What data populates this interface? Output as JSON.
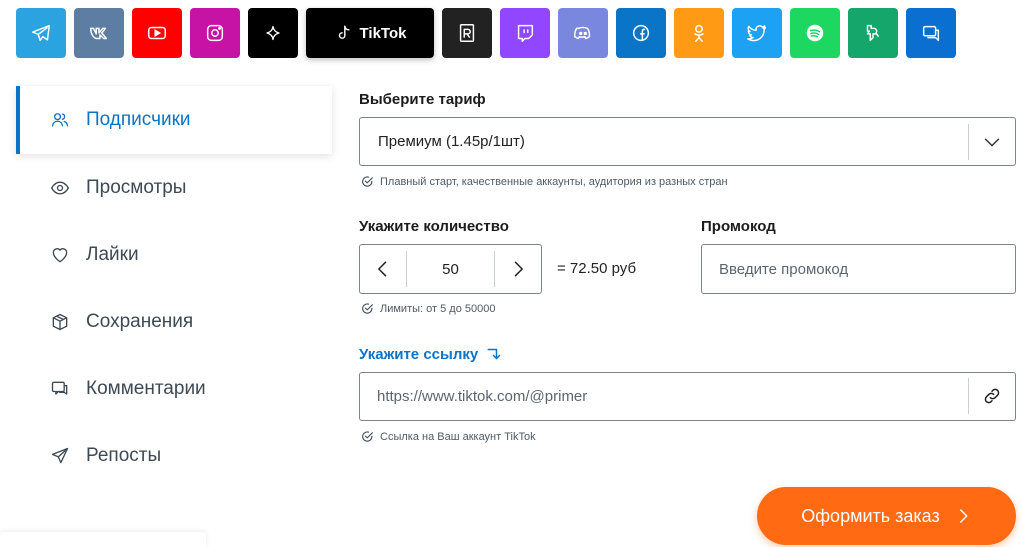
{
  "platforms": [
    {
      "name": "telegram",
      "color": "#2aa3e0"
    },
    {
      "name": "vk",
      "color": "#5d7ea2"
    },
    {
      "name": "youtube",
      "color": "#ff0000"
    },
    {
      "name": "instagram",
      "color": "#c613a6"
    },
    {
      "name": "sparkle",
      "color": "#000000"
    },
    {
      "name": "tiktok",
      "color": "#000000",
      "label": "TikTok"
    },
    {
      "name": "rutube",
      "color": "#222222"
    },
    {
      "name": "twitch",
      "color": "#9146ff"
    },
    {
      "name": "discord",
      "color": "#7a87de"
    },
    {
      "name": "facebook",
      "color": "#0a74c6"
    },
    {
      "name": "odnoklassniki",
      "color": "#ff9a14"
    },
    {
      "name": "twitter",
      "color": "#1da1f2"
    },
    {
      "name": "spotify",
      "color": "#1ed760"
    },
    {
      "name": "likee",
      "color": "#15a66b"
    },
    {
      "name": "chat",
      "color": "#0a6fd1"
    }
  ],
  "sidebar": {
    "items": [
      {
        "label": "Подписчики",
        "icon": "users-icon"
      },
      {
        "label": "Просмотры",
        "icon": "eye-icon"
      },
      {
        "label": "Лайки",
        "icon": "heart-icon"
      },
      {
        "label": "Сохранения",
        "icon": "box-icon"
      },
      {
        "label": "Комментарии",
        "icon": "comments-icon"
      },
      {
        "label": "Репосты",
        "icon": "send-icon"
      }
    ]
  },
  "form": {
    "tariff_label": "Выберите тариф",
    "tariff_value": "Премиум (1.45р/1шт)",
    "tariff_hint": "Плавный старт, качественные аккаунты, аудитория из разных стран",
    "quantity_label": "Укажите количество",
    "quantity_value": "50",
    "total": "= 72.50 руб",
    "quantity_hint": "Лимиты: от 5 до 50000",
    "promo_label": "Промокод",
    "promo_placeholder": "Введите промокод",
    "link_label": "Укажите ссылку",
    "link_placeholder": "https://www.tiktok.com/@primer",
    "link_hint": "Ссылка на Ваш аккаунт TikTok",
    "order_button": "Оформить заказ"
  },
  "colors": {
    "accent": "#0a74c6",
    "order": "#ff6a13"
  }
}
